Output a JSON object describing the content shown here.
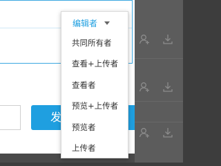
{
  "share_dialog": {
    "permission_select": {
      "selected_label": "编辑者",
      "options": [
        "共同所有者",
        "查看+上传者",
        "查看者",
        "预览+上传者",
        "预览者",
        "上传者"
      ]
    },
    "send_button_label": "发"
  },
  "icons": {
    "row_actions": [
      "add-member-icon",
      "download-icon"
    ]
  },
  "colors": {
    "accent": "#1f9fe0",
    "overlay": "#5c5c5c"
  }
}
